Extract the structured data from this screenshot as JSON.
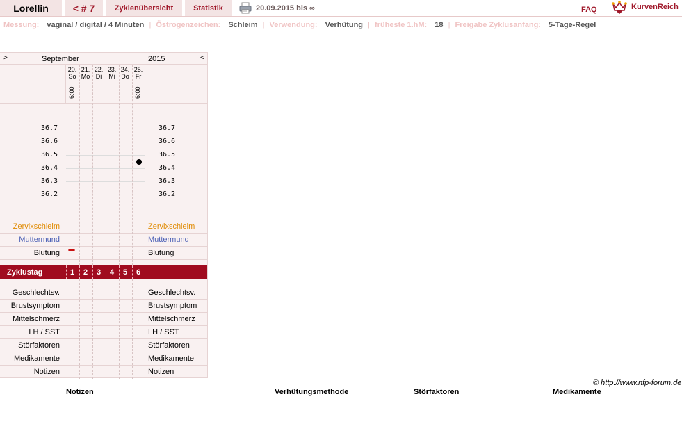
{
  "tabs": {
    "name": "Lorellin",
    "cycle": "< # 7",
    "overview": "Zyklenübersicht",
    "stats": "Statistik"
  },
  "header": {
    "print_icon": "printer-icon",
    "date_range": "20.09.2015 bis ∞",
    "faq": "FAQ",
    "brand": "KurvenReich",
    "brand_icon": "crown-heart-logo"
  },
  "info": {
    "measure_label": "Messung:",
    "measure_value": "vaginal / digital / 4 Minuten",
    "estrogen_label": "Östrogenzeichen:",
    "estrogen_value": "Schleim",
    "use_label": "Verwendung:",
    "use_value": "Verhütung",
    "earliest_label": "früheste 1.hM:",
    "earliest_value": "18",
    "release_label": "Freigabe Zyklusanfang:",
    "release_value": "5-Tage-Regel"
  },
  "chart": {
    "prev_arrow": ">",
    "next_arrow": "<",
    "month": "September",
    "year": "2015",
    "days": [
      {
        "date": "20.",
        "wd": "So",
        "time": "6:00"
      },
      {
        "date": "21.",
        "wd": "Mo",
        "time": ""
      },
      {
        "date": "22.",
        "wd": "Di",
        "time": ""
      },
      {
        "date": "23.",
        "wd": "Mi",
        "time": ""
      },
      {
        "date": "24.",
        "wd": "Do",
        "time": ""
      },
      {
        "date": "25.",
        "wd": "Fr",
        "time": "6:00"
      }
    ],
    "temps": [
      "36.7",
      "36.6",
      "36.5",
      "36.4",
      "36.3",
      "36.2"
    ],
    "rows": {
      "mucus": "Zervixschleim",
      "cervix": "Muttermund",
      "bleeding": "Blutung",
      "cycleday": "Zyklustag",
      "intercourse": "Geschlechtsv.",
      "breast": "Brustsymptom",
      "midpain": "Mittelschmerz",
      "lh": "LH / SST",
      "disturb": "Störfaktoren",
      "meds": "Medikamente",
      "notes": "Notizen"
    },
    "cycle_days": [
      "1",
      "2",
      "3",
      "4",
      "5",
      "6"
    ]
  },
  "chart_data": {
    "type": "line",
    "x": [
      "20.",
      "21.",
      "22.",
      "23.",
      "24.",
      "25."
    ],
    "series": [
      {
        "values": [
          null,
          null,
          null,
          null,
          null,
          36.45
        ]
      }
    ],
    "ylim": [
      36.2,
      36.7
    ],
    "bleeding": [
      1,
      0,
      0,
      0,
      0,
      0
    ]
  },
  "footer": {
    "copyright": "© http://www.nfp-forum.de",
    "col_notes": "Notizen",
    "col_method": "Verhütungsmethode",
    "col_disturb": "Störfaktoren",
    "col_meds": "Medikamente"
  }
}
